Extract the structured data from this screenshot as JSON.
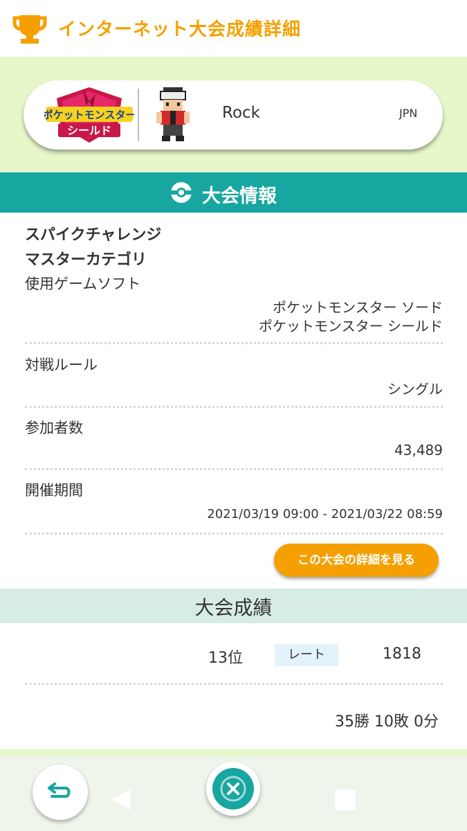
{
  "header": {
    "title": "インターネット大会成績詳細",
    "icon": "trophy-icon"
  },
  "profile": {
    "game_logo_line1": "ポケットモンスター",
    "game_logo_line2": "シールド",
    "player_name": "Rock",
    "region": "JPN"
  },
  "section": {
    "title": "大会情報"
  },
  "tournament": {
    "name_line1": "スパイクチャレンジ",
    "name_line2": "マスターカテゴリ",
    "software_label": "使用ゲームソフト",
    "software_value1": "ポケットモンスター ソード",
    "software_value2": "ポケットモンスター シールド",
    "rule_label": "対戦ルール",
    "rule_value": "シングル",
    "participants_label": "参加者数",
    "participants_value": "43,489",
    "period_label": "開催期間",
    "period_value": "2021/03/19 09:00 - 2021/03/22 08:59",
    "detail_button": "この大会の詳細を見る"
  },
  "results": {
    "title": "大会成績",
    "rank": "13位",
    "rate_label": "レート",
    "rate_value": "1818",
    "record": "35勝 10敗 0分"
  },
  "colors": {
    "accent": "#f5a000",
    "teal": "#18a6a1",
    "light_green": "#e6f8c9"
  }
}
